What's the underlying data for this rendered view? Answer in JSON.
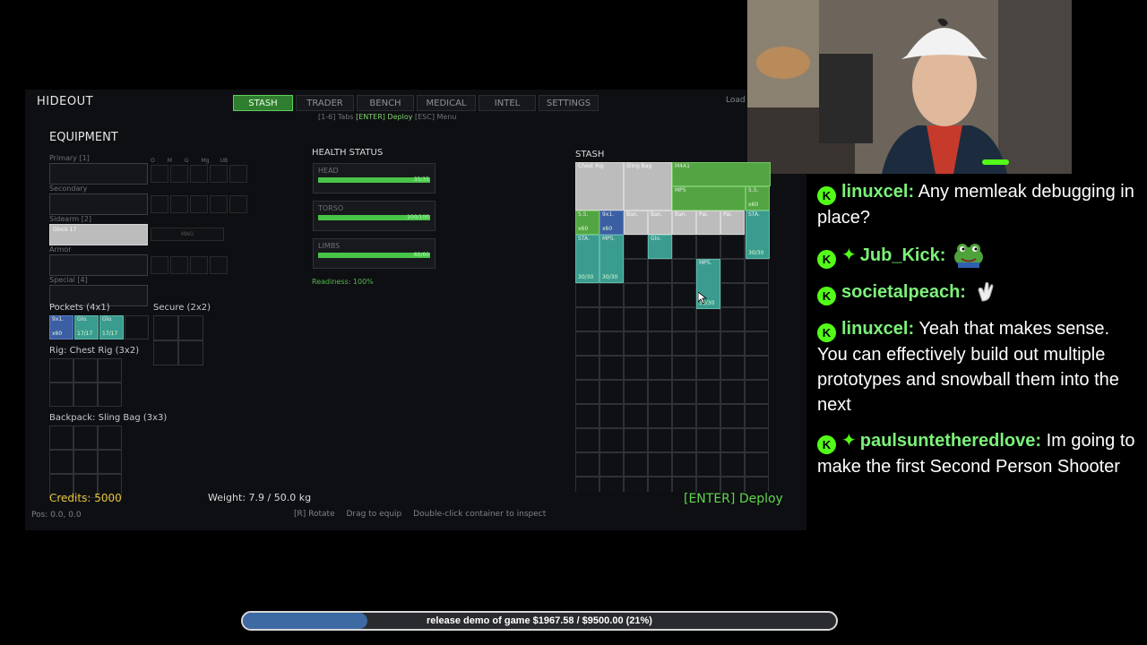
{
  "game": {
    "title": "HIDEOUT",
    "tabs": [
      "STASH",
      "TRADER",
      "BENCH",
      "MEDICAL",
      "INTEL",
      "SETTINGS"
    ],
    "active_tab": "STASH",
    "load_label": "Load",
    "hint_prefix": "[1-6] Tabs",
    "hint_enter": "[ENTER] Deploy",
    "hint_suffix": "[ESC] Menu",
    "equipment": {
      "heading": "EQUIPMENT",
      "slots": [
        {
          "label": "Primary [1]",
          "value": ""
        },
        {
          "label": "Secondary",
          "value": ""
        },
        {
          "label": "Sidearm [2]",
          "value": "Glock 17"
        },
        {
          "label": "Armor",
          "value": ""
        },
        {
          "label": "Special [4]",
          "value": ""
        }
      ],
      "attach_labels": [
        "O",
        "M",
        "G",
        "Mg",
        "UB"
      ],
      "sidearm_attach": "MAG",
      "pockets_label": "Pockets (4x1)",
      "secure_label": "Secure (2x2)",
      "rig_label": "Rig: Chest Rig (3x2)",
      "backpack_label": "Backpack: Sling Bag (3x3)",
      "pocket_items": [
        {
          "name": "9x1.",
          "qty": "x60",
          "color": "blue"
        },
        {
          "name": "Glo.",
          "qty": "17/17",
          "color": "teal"
        },
        {
          "name": "Glo.",
          "qty": "17/17",
          "color": "teal"
        }
      ]
    },
    "health": {
      "heading": "HEALTH STATUS",
      "parts": [
        {
          "name": "HEAD",
          "value": "35/35",
          "fraction": 1.0
        },
        {
          "name": "TORSO",
          "value": "100/100",
          "fraction": 1.0
        },
        {
          "name": "LIMBS",
          "value": "60/60",
          "fraction": 1.0
        }
      ],
      "readiness": "Readiness: 100%"
    },
    "stash": {
      "heading": "STASH",
      "items": [
        {
          "name": "Chest Rig",
          "qty": "",
          "color": "gray"
        },
        {
          "name": "Sling Bag",
          "qty": "",
          "color": "gray"
        },
        {
          "name": "M4A1",
          "qty": "",
          "color": "green"
        },
        {
          "name": "MP5",
          "qty": "",
          "color": "green"
        },
        {
          "name": "5.5.",
          "qty": "x60",
          "color": "green"
        },
        {
          "name": "5.5.",
          "qty": "x60",
          "color": "green"
        },
        {
          "name": "9x1.",
          "qty": "x60",
          "color": "blue"
        },
        {
          "name": "Ban.",
          "qty": "",
          "color": "gray"
        },
        {
          "name": "Ban.",
          "qty": "",
          "color": "gray"
        },
        {
          "name": "Ban.",
          "qty": "",
          "color": "gray"
        },
        {
          "name": "Pai.",
          "qty": "",
          "color": "gray"
        },
        {
          "name": "Pai.",
          "qty": "",
          "color": "gray"
        },
        {
          "name": "STA.",
          "qty": "30/30",
          "color": "teal"
        },
        {
          "name": "STA.",
          "qty": "30/30",
          "color": "teal"
        },
        {
          "name": "MP5.",
          "qty": "30/30",
          "color": "teal"
        },
        {
          "name": "Glo.",
          "qty": "",
          "color": "teal"
        },
        {
          "name": "MP5.",
          "qty": "30/30",
          "color": "teal"
        }
      ]
    },
    "credits": "Credits: 5000",
    "weight": "Weight: 7.9 / 50.0 kg",
    "deploy": "[ENTER] Deploy",
    "pos": "Pos: 0.0, 0.0",
    "controls": [
      "[R] Rotate",
      "Drag to equip",
      "Double-click container to inspect"
    ]
  },
  "chat": [
    {
      "user": "linuxcel:",
      "star": false,
      "text": "Any memleak debugging in place?"
    },
    {
      "user": "Jub_Kick:",
      "star": true,
      "text": "",
      "emote": "frog-emote"
    },
    {
      "user": "societalpeach:",
      "star": false,
      "text": "",
      "emote": "clap-emote"
    },
    {
      "user": "linuxcel:",
      "star": false,
      "text": "Yeah that makes sense. You can effectively build out multiple prototypes and snowball them into the next"
    },
    {
      "user": "paulsuntetheredlove:",
      "star": true,
      "text": "Im going to make the first Second Person Shooter"
    }
  ],
  "donation": {
    "text": "release demo of game $1967.58 / $9500.00 (21%)",
    "fraction": 0.21
  },
  "colors": {
    "accent_green": "#48c448",
    "kick_green": "#53fc18",
    "progress_fill": "#3d6aa3"
  }
}
